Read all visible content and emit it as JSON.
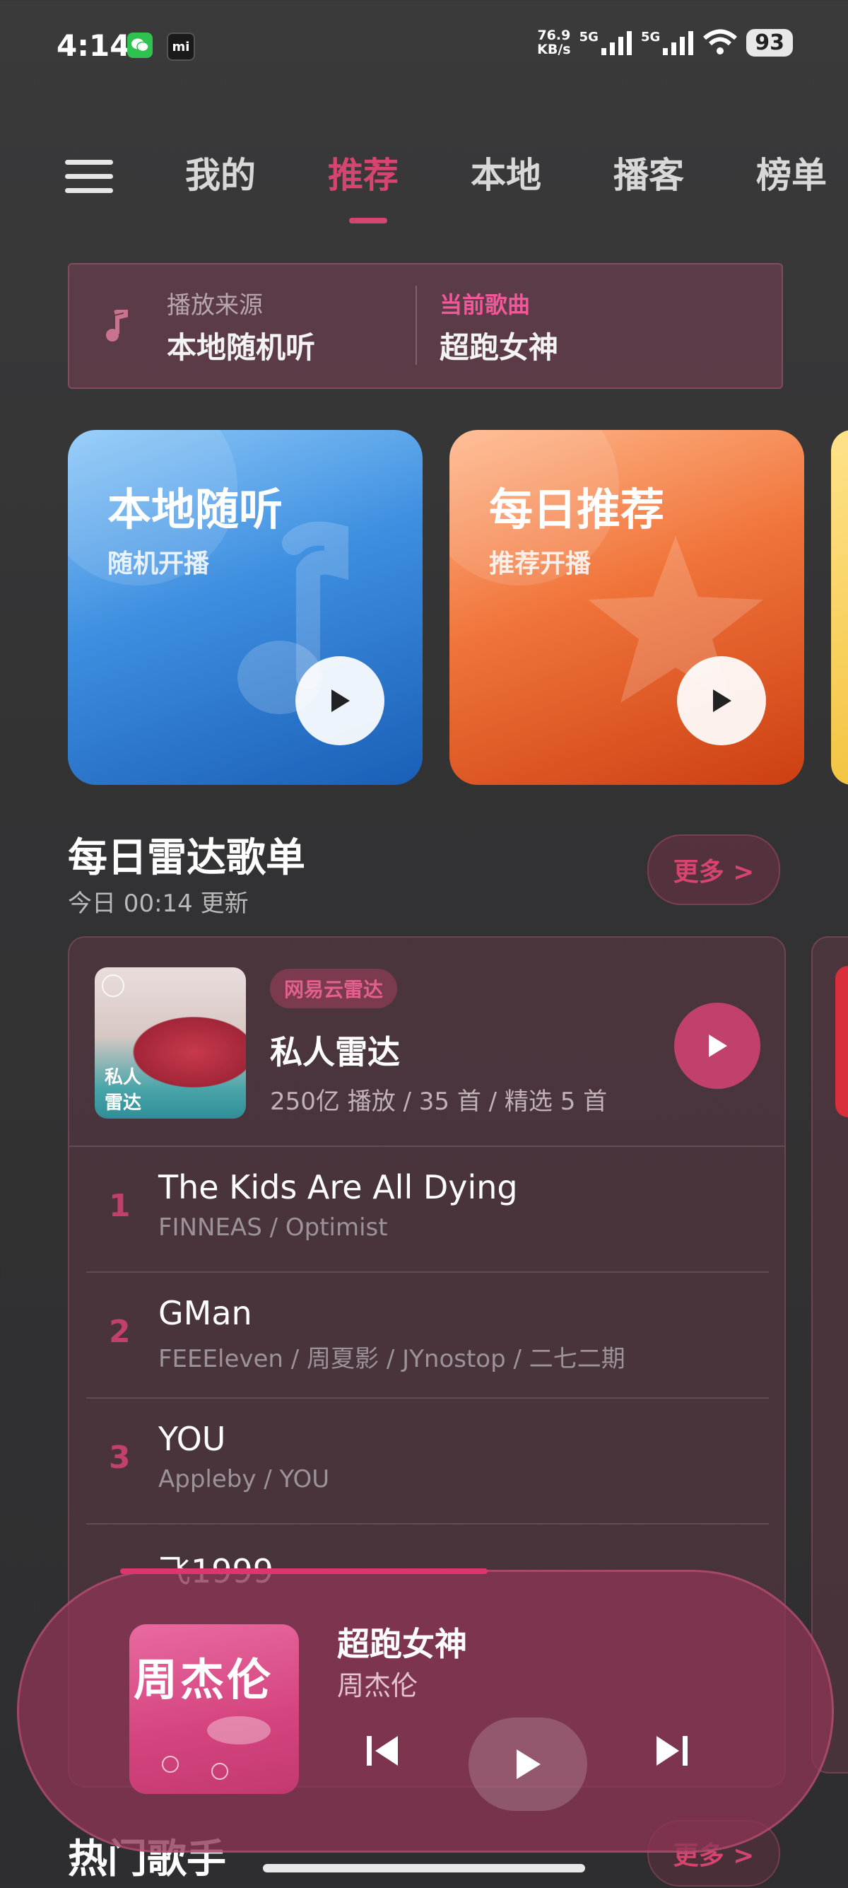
{
  "status_bar": {
    "time": "4:14",
    "wechat_icon": "wechat-icon",
    "mi_icon": "mi",
    "net_speed_value": "76.9",
    "net_speed_unit": "KB/s",
    "sig1_label": "5G",
    "sig2_label": "5G",
    "battery": "93"
  },
  "nav": {
    "tabs": [
      {
        "label": "我的"
      },
      {
        "label": "推荐"
      },
      {
        "label": "本地"
      },
      {
        "label": "播客"
      },
      {
        "label": "榜单"
      }
    ],
    "active_tab": "推荐"
  },
  "source": {
    "label": "播放来源",
    "value": "本地随机听",
    "current_label": "当前歌曲",
    "current_value": "超跑女神"
  },
  "cards": [
    {
      "title": "本地随听",
      "subtitle": "随机开播",
      "color": "#3d8ee0"
    },
    {
      "title": "每日推荐",
      "subtitle": "推荐开播",
      "color": "#f0743a"
    }
  ],
  "radar_section": {
    "title": "每日雷达歌单",
    "subtitle": "今日 00:14 更新",
    "more_label": "更多 >",
    "playlist": {
      "cover_text_1": "私人",
      "cover_text_2": "雷达",
      "tag": "网易云雷达",
      "name": "私人雷达",
      "meta": "250亿 播放 / 35 首 / 精选 5 首"
    },
    "tracks": [
      {
        "num": "1",
        "title": "The Kids Are All Dying",
        "artist": "FINNEAS / Optimist"
      },
      {
        "num": "2",
        "title": "GMan",
        "artist": "FEEEleven / 周夏影 / JYnostop / 二七二期"
      },
      {
        "num": "3",
        "title": "YOU",
        "artist": "Appleby / YOU"
      },
      {
        "num": "",
        "title": "飞1999",
        "artist": ""
      }
    ]
  },
  "player": {
    "title": "超跑女神",
    "artist": "周杰伦",
    "cover_text": "周杰伦",
    "progress": 0.5
  },
  "bottom_section": {
    "title": "热门歌手",
    "more_label": "更多 >"
  },
  "colors": {
    "accent": "#d6456f",
    "player_bg": "#8c3454"
  }
}
